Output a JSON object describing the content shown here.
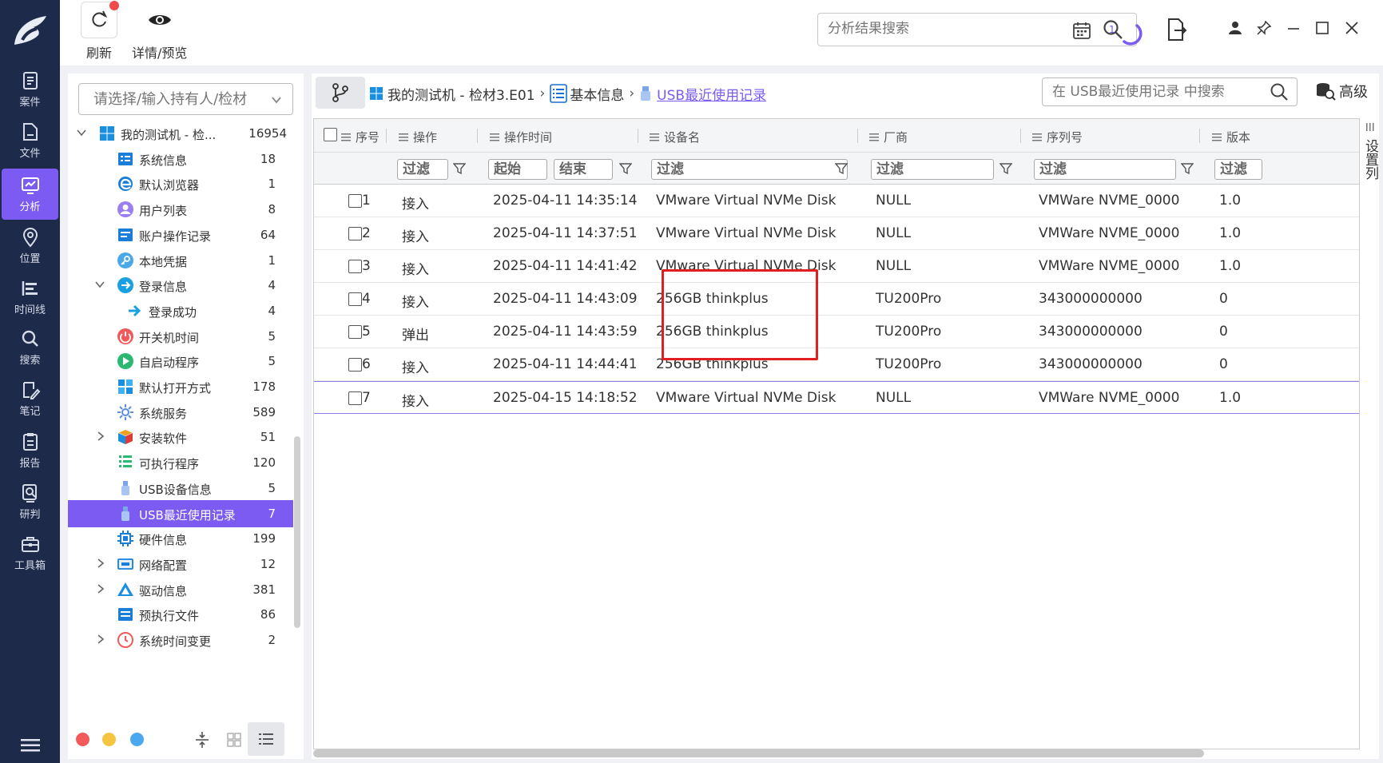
{
  "nav": {
    "items": [
      {
        "label": "案件",
        "icon": "case-icon"
      },
      {
        "label": "文件",
        "icon": "file-icon"
      },
      {
        "label": "分析",
        "icon": "analysis-icon",
        "active": true
      },
      {
        "label": "位置",
        "icon": "location-icon"
      },
      {
        "label": "时间线",
        "icon": "timeline-icon"
      },
      {
        "label": "搜索",
        "icon": "search-icon"
      },
      {
        "label": "笔记",
        "icon": "note-icon"
      },
      {
        "label": "报告",
        "icon": "report-icon"
      },
      {
        "label": "研判",
        "icon": "judge-icon"
      },
      {
        "label": "工具箱",
        "icon": "toolbox-icon"
      }
    ]
  },
  "toolbar": {
    "refresh_label": "刷新",
    "preview_label": "详情/预览",
    "search_placeholder": "分析结果搜索",
    "progress_count": "1"
  },
  "side": {
    "select_placeholder": "请选择/输入持有人/检材",
    "tree": [
      {
        "label": "我的测试机 - 检...",
        "count": "16954",
        "level": 0,
        "expanded": true,
        "icon": "windows-icon"
      },
      {
        "label": "系统信息",
        "count": "18",
        "level": 1,
        "icon": "system-info-icon"
      },
      {
        "label": "默认浏览器",
        "count": "1",
        "level": 1,
        "icon": "browser-icon"
      },
      {
        "label": "用户列表",
        "count": "8",
        "level": 1,
        "icon": "user-icon"
      },
      {
        "label": "账户操作记录",
        "count": "64",
        "level": 1,
        "icon": "account-log-icon"
      },
      {
        "label": "本地凭据",
        "count": "1",
        "level": 1,
        "icon": "key-icon"
      },
      {
        "label": "登录信息",
        "count": "4",
        "level": 1,
        "expanded": true,
        "icon": "login-icon"
      },
      {
        "label": "登录成功",
        "count": "4",
        "level": 2,
        "icon": "login-success-icon"
      },
      {
        "label": "开关机时间",
        "count": "5",
        "level": 1,
        "icon": "power-icon"
      },
      {
        "label": "自启动程序",
        "count": "5",
        "level": 1,
        "icon": "autostart-icon"
      },
      {
        "label": "默认打开方式",
        "count": "178",
        "level": 1,
        "icon": "default-open-icon"
      },
      {
        "label": "系统服务",
        "count": "589",
        "level": 1,
        "icon": "service-icon"
      },
      {
        "label": "安装软件",
        "count": "51",
        "level": 1,
        "collapsed": true,
        "icon": "software-icon"
      },
      {
        "label": "可执行程序",
        "count": "120",
        "level": 1,
        "icon": "executable-icon"
      },
      {
        "label": "USB设备信息",
        "count": "5",
        "level": 1,
        "icon": "usb-icon"
      },
      {
        "label": "USB最近使用记录",
        "count": "7",
        "level": 1,
        "active": true,
        "icon": "usb-icon"
      },
      {
        "label": "硬件信息",
        "count": "199",
        "level": 1,
        "icon": "chip-icon"
      },
      {
        "label": "网络配置",
        "count": "12",
        "level": 1,
        "collapsed": true,
        "icon": "network-icon"
      },
      {
        "label": "驱动信息",
        "count": "381",
        "level": 1,
        "collapsed": true,
        "icon": "driver-icon"
      },
      {
        "label": "预执行文件",
        "count": "86",
        "level": 1,
        "icon": "prefetch-icon"
      },
      {
        "label": "系统时间变更",
        "count": "2",
        "level": 1,
        "collapsed": true,
        "icon": "clock-icon"
      }
    ]
  },
  "breadcrumb": {
    "device": "我的测试机 - 检材3.E01",
    "category": "基本信息",
    "current": "USB最近使用记录"
  },
  "main": {
    "search_placeholder": "在 USB最近使用记录 中搜索",
    "advanced_label": "高级",
    "set_columns_label": "设置列"
  },
  "table": {
    "columns": [
      "序号",
      "操作",
      "操作时间",
      "设备名",
      "厂商",
      "序列号",
      "版本"
    ],
    "filter_label": "过滤",
    "filter_start": "起始",
    "filter_end": "结束",
    "rows": [
      {
        "no": "1",
        "op": "接入",
        "time": "2025-04-11 14:35:14",
        "device": "VMware Virtual NVMe Disk",
        "vendor": "NULL",
        "serial": "VMWare NVME_0000",
        "version": "1.0"
      },
      {
        "no": "2",
        "op": "接入",
        "time": "2025-04-11 14:37:51",
        "device": "VMware Virtual NVMe Disk",
        "vendor": "NULL",
        "serial": "VMWare NVME_0000",
        "version": "1.0"
      },
      {
        "no": "3",
        "op": "接入",
        "time": "2025-04-11 14:41:42",
        "device": "VMware Virtual NVMe Disk",
        "vendor": "NULL",
        "serial": "VMWare NVME_0000",
        "version": "1.0"
      },
      {
        "no": "4",
        "op": "接入",
        "time": "2025-04-11 14:43:09",
        "device": "256GB thinkplus",
        "vendor": "TU200Pro",
        "serial": "343000000000",
        "version": "0"
      },
      {
        "no": "5",
        "op": "弹出",
        "time": "2025-04-11 14:43:59",
        "device": "256GB thinkplus",
        "vendor": "TU200Pro",
        "serial": "343000000000",
        "version": "0"
      },
      {
        "no": "6",
        "op": "接入",
        "time": "2025-04-11 14:44:41",
        "device": "256GB thinkplus",
        "vendor": "TU200Pro",
        "serial": "343000000000",
        "version": "0"
      },
      {
        "no": "7",
        "op": "接入",
        "time": "2025-04-15 14:18:52",
        "device": "VMware Virtual NVMe Disk",
        "vendor": "NULL",
        "serial": "VMWare NVME_0000",
        "version": "1.0"
      }
    ]
  },
  "colors": {
    "accent": "#7b5bf2",
    "nav_bg": "#1e2a4a",
    "highlight_box": "#e02020",
    "dot_red": "#f05a5a",
    "dot_yellow": "#f5c542",
    "dot_blue": "#4aa8f0"
  }
}
